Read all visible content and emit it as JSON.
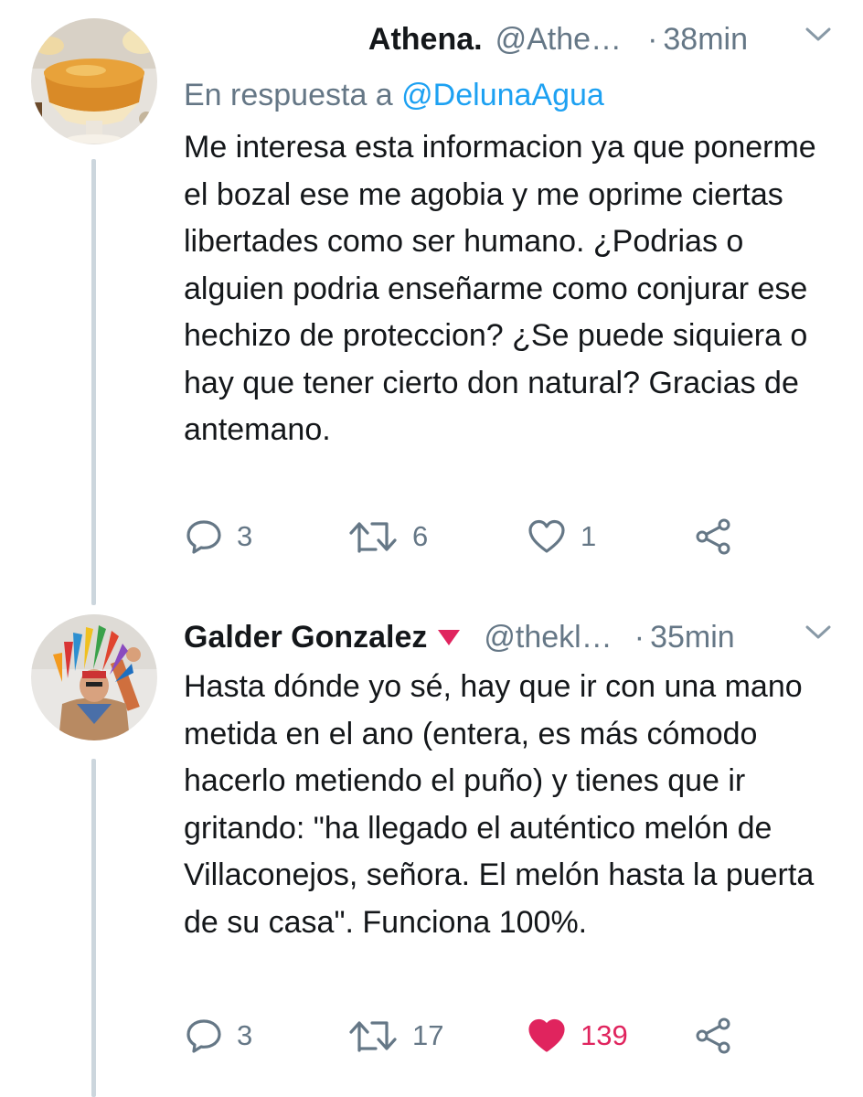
{
  "tweets": [
    {
      "name": "Athena.",
      "handle": "@Athe…",
      "time": "38min",
      "reply_prefix": "En respuesta a",
      "reply_mention": "@DelunaAgua",
      "text": "Me interesa esta informacion ya que ponerme el bozal ese me agobia y me oprime ciertas libertades como ser humano. ¿Podrias o alguien podria enseñarme como conjurar ese hechizo de proteccion? ¿Se puede siquiera o hay que tener cierto don natural? Gracias de antemano.",
      "replies": "3",
      "retweets": "6",
      "likes": "1",
      "liked": false
    },
    {
      "name": "Galder Gonzalez",
      "handle": "@thekl…",
      "time": "35min",
      "text": "Hasta dónde yo sé, hay que ir con una mano metida en el ano (entera, es más cómodo hacerlo metiendo el puño) y tienes que ir gritando: \"ha llegado el auténtico melón de Villaconejos, señora. El melón hasta la puerta de su casa\". Funciona 100%.",
      "replies": "3",
      "retweets": "17",
      "likes": "139",
      "liked": true
    }
  ],
  "icons": {
    "reply": "reply-icon",
    "retweet": "retweet-icon",
    "like": "heart-icon",
    "share": "share-icon",
    "caret": "chevron-down-icon",
    "verified": "red-triangle-badge-icon"
  },
  "colors": {
    "text": "#14171a",
    "secondary": "#657786",
    "link": "#1da1f2",
    "like": "#e0245e",
    "thread_line": "#ccd6dd"
  }
}
